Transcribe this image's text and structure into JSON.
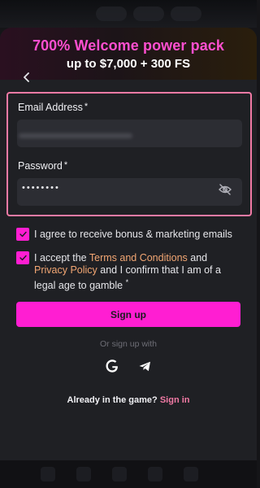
{
  "promo": {
    "title": "700% Welcome power pack",
    "subtitle": "up to $7,000 + 300 FS"
  },
  "form": {
    "email_label": "Email Address",
    "password_label": "Password",
    "required_mark": "*",
    "password_value": "••••••••"
  },
  "consents": {
    "marketing": "I agree to receive bonus & marketing emails",
    "terms_prefix": "I accept the ",
    "terms_link": "Terms and Conditions",
    "terms_mid": " and ",
    "privacy_link": "Privacy Policy",
    "terms_suffix": " and I confirm that I am of a legal age to gamble",
    "required_mark": "*"
  },
  "actions": {
    "signup_label": "Sign up",
    "or_text": "Or sign up with",
    "signin_prompt": "Already in the game?",
    "signin_link": "Sign in"
  },
  "icons": {
    "back": "chevron-left-icon",
    "toggle_password": "eye-off-icon",
    "google": "google-icon",
    "telegram": "telegram-icon"
  },
  "colors": {
    "accent": "#ff1ed2",
    "promo_title": "#ff4fd0",
    "link": "#f2a673",
    "focus_border": "#f27aa5"
  }
}
